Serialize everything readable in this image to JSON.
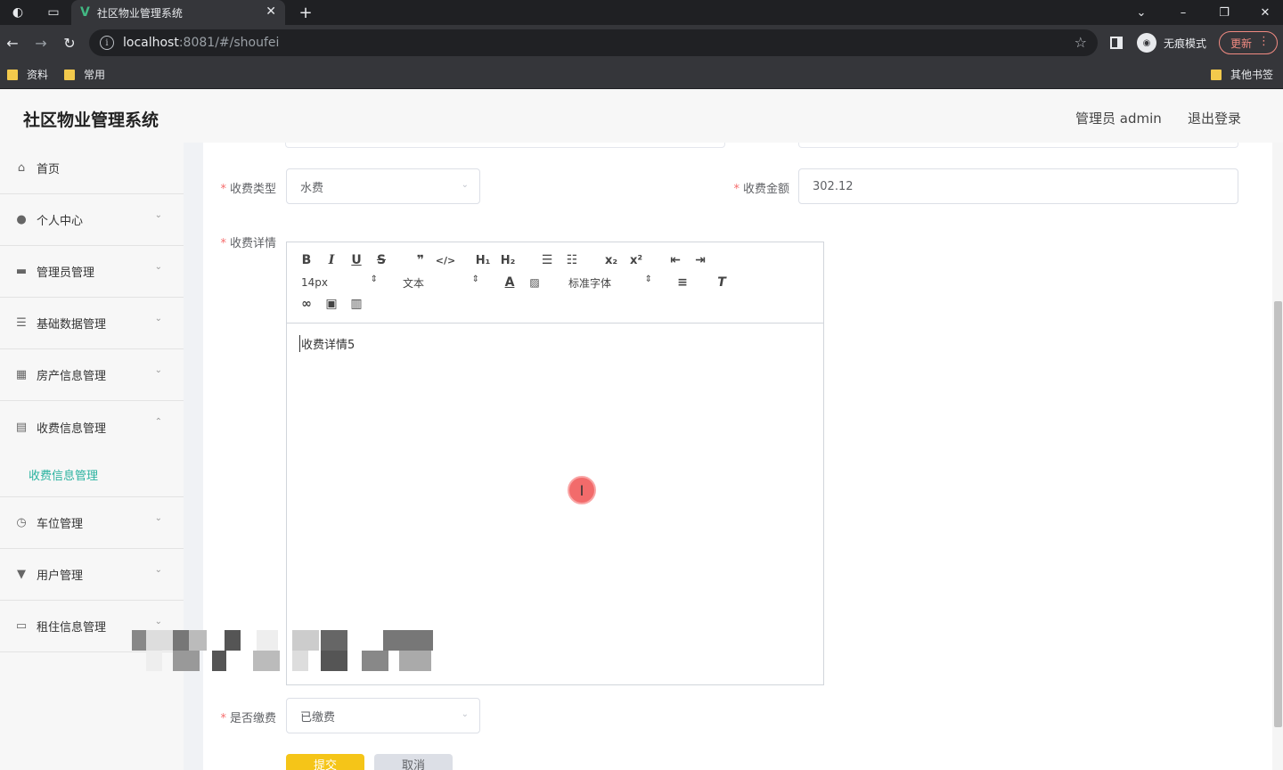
{
  "browser": {
    "tab_title": "社区物业管理系统",
    "url_host": "localhost",
    "url_path": ":8081/#/shoufei",
    "incognito_label": "无痕模式",
    "update_label": "更新",
    "bookmarks": [
      "资料",
      "常用"
    ],
    "other_bookmarks": "其他书签"
  },
  "header": {
    "title": "社区物业管理系统",
    "user": "管理员 admin",
    "logout": "退出登录"
  },
  "sidebar": {
    "items": [
      {
        "label": "首页",
        "icon": "home-icon"
      },
      {
        "label": "个人中心",
        "icon": "user-icon"
      },
      {
        "label": "管理员管理",
        "icon": "ticket-icon"
      },
      {
        "label": "基础数据管理",
        "icon": "list-icon"
      },
      {
        "label": "房产信息管理",
        "icon": "grid-icon"
      },
      {
        "label": "收费信息管理",
        "icon": "document-icon"
      },
      {
        "label": "车位管理",
        "icon": "clock-icon"
      },
      {
        "label": "用户管理",
        "icon": "sign-icon"
      },
      {
        "label": "租住信息管理",
        "icon": "monitor-icon"
      }
    ],
    "active_sub": "收费信息管理"
  },
  "form": {
    "fee_type_label": "收费类型",
    "fee_type_value": "水费",
    "amount_label": "收费金额",
    "amount_value": "302.12",
    "detail_label": "收费详情",
    "editor": {
      "font_size": "14px",
      "format": "文本",
      "font_family": "标准字体",
      "content": "收费详情5"
    },
    "paid_label": "是否缴费",
    "paid_value": "已缴费",
    "submit_label": "提交",
    "cancel_label": "取消"
  },
  "colors": {
    "accent": "#2bb3a0",
    "primary_button": "#f5c518",
    "required": "#f56c6c"
  }
}
